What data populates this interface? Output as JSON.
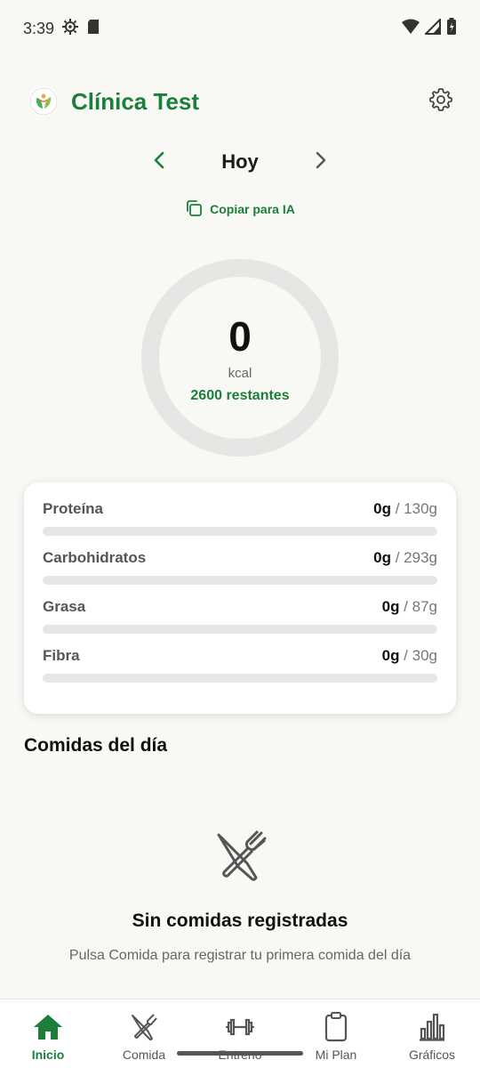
{
  "status_bar": {
    "time": "3:39"
  },
  "header": {
    "app_title": "Clínica Test"
  },
  "date_nav": {
    "label": "Hoy"
  },
  "copy_button": {
    "label": "Copiar para IA"
  },
  "calories": {
    "value": "0",
    "unit": "kcal",
    "remaining": "2600 restantes",
    "progress": 0
  },
  "macros": [
    {
      "name": "Proteína",
      "current": "0g",
      "target": " / 130g",
      "progress": 0
    },
    {
      "name": "Carbohidratos",
      "current": "0g",
      "target": " / 293g",
      "progress": 0
    },
    {
      "name": "Grasa",
      "current": "0g",
      "target": " / 87g",
      "progress": 0
    },
    {
      "name": "Fibra",
      "current": "0g",
      "target": " / 30g",
      "progress": 0
    }
  ],
  "meals": {
    "section_title": "Comidas del día",
    "empty_title": "Sin comidas registradas",
    "empty_subtitle": "Pulsa Comida para registrar tu primera comida del día"
  },
  "bottom_nav": {
    "items": [
      {
        "label": "Inicio",
        "icon": "home-icon",
        "active": true
      },
      {
        "label": "Comida",
        "icon": "utensils-icon",
        "active": false
      },
      {
        "label": "Entreno",
        "icon": "dumbbell-icon",
        "active": false
      },
      {
        "label": "Mi Plan",
        "icon": "clipboard-icon",
        "active": false
      },
      {
        "label": "Gráficos",
        "icon": "bar-chart-icon",
        "active": false
      }
    ]
  },
  "colors": {
    "accent": "#1b7f3a",
    "ring_track": "#e6e6e4",
    "background": "#f8f8f5"
  }
}
